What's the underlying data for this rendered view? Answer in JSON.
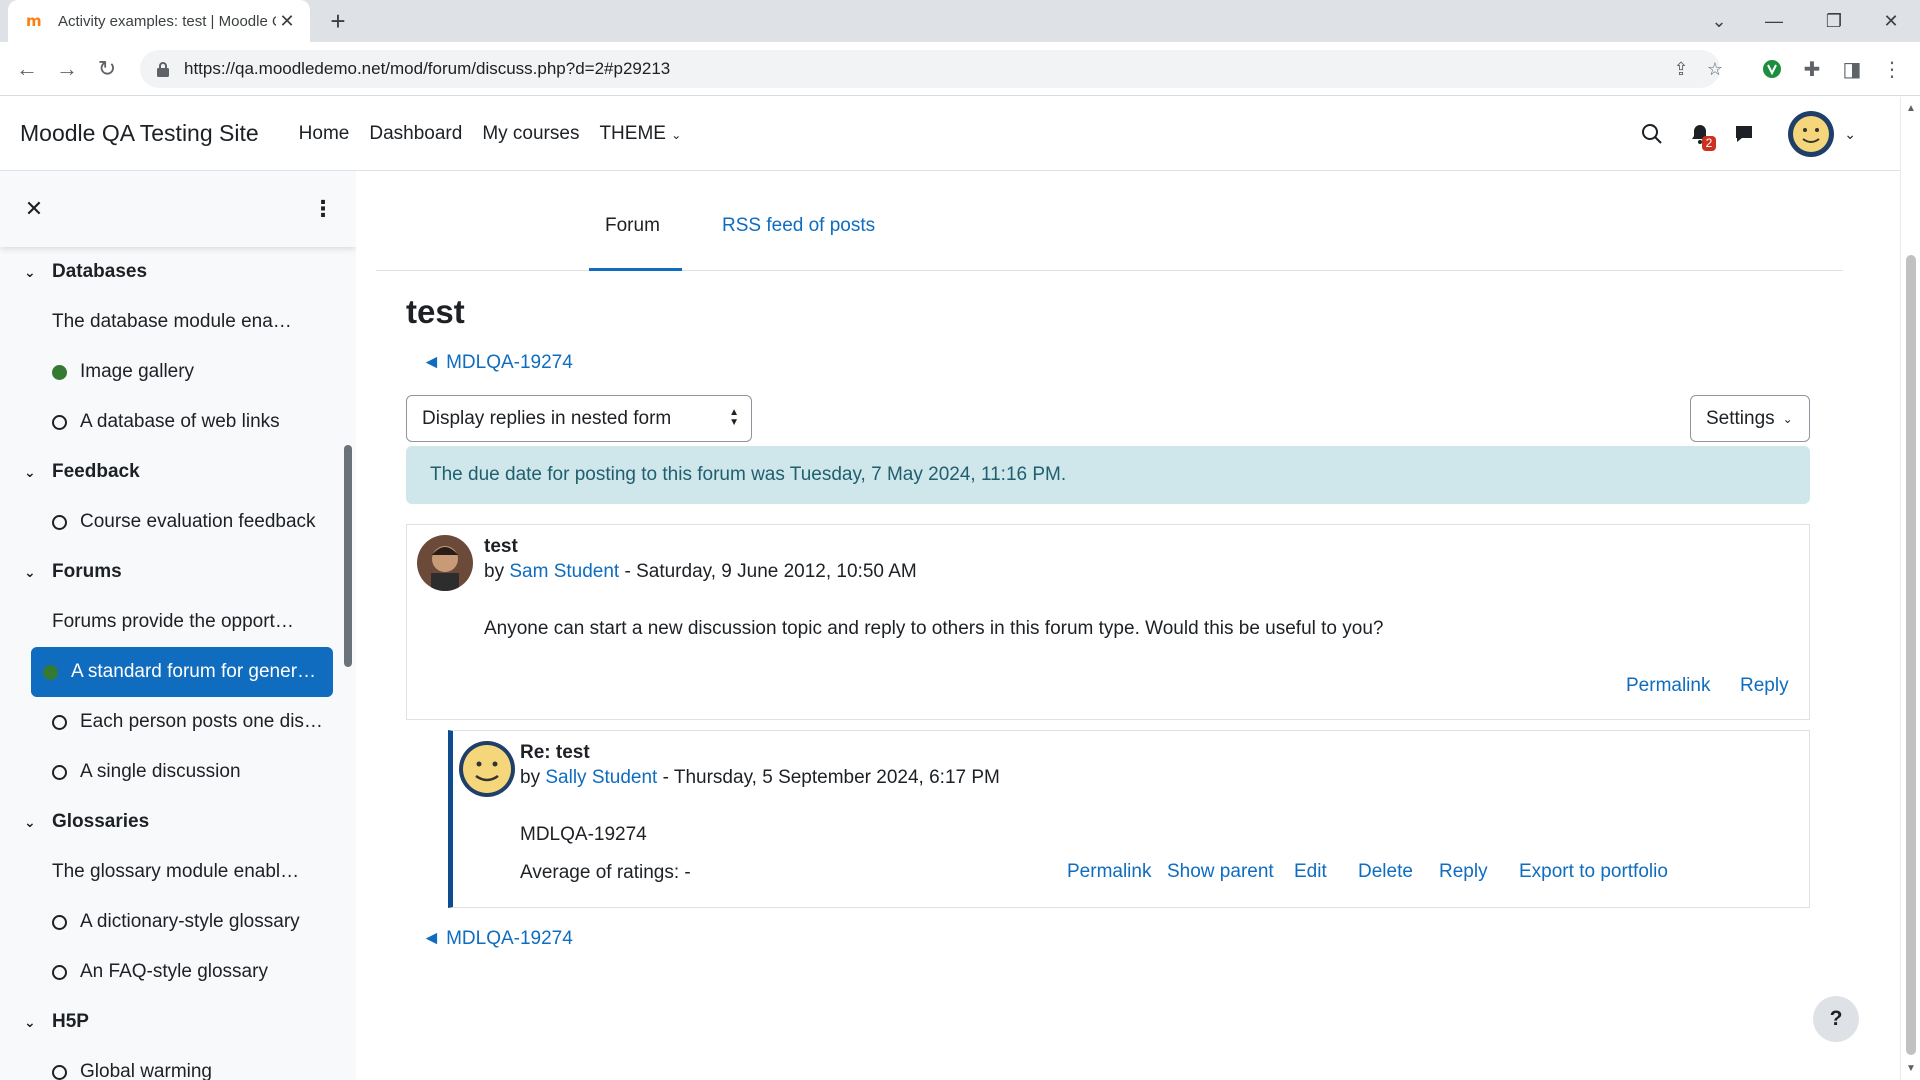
{
  "browser": {
    "tab_title": "Activity examples: test | Moodle QA Testing Site",
    "tab_favicon": "m",
    "tab_close": "✕",
    "new_tab": "+",
    "url": "https://qa.moodledemo.net/mod/forum/discuss.php?d=2#p29213"
  },
  "navbar": {
    "site_name": "Moodle QA Testing Site",
    "links": [
      "Home",
      "Dashboard",
      "My courses",
      "THEME"
    ],
    "notification_count": "2"
  },
  "drawer": {
    "close": "✕",
    "menu": "⋮",
    "sections": [
      {
        "title": "Databases",
        "items": [
          {
            "label": "The database module enables ...",
            "status": "summary"
          },
          {
            "label": "Image gallery",
            "status": "done"
          },
          {
            "label": "A database of web links",
            "status": "open"
          }
        ]
      },
      {
        "title": "Feedback",
        "items": [
          {
            "label": "Course evaluation feedback",
            "status": "open"
          }
        ]
      },
      {
        "title": "Forums",
        "items": [
          {
            "label": "Forums provide the opportunit...",
            "status": "summary"
          },
          {
            "label": "A standard forum for genera...",
            "status": "done",
            "active": true
          },
          {
            "label": "Each person posts one discu...",
            "status": "open"
          },
          {
            "label": "A single discussion",
            "status": "open"
          }
        ]
      },
      {
        "title": "Glossaries",
        "items": [
          {
            "label": "The glossary module enables p...",
            "status": "summary"
          },
          {
            "label": "A dictionary-style glossary",
            "status": "open"
          },
          {
            "label": "An FAQ-style glossary",
            "status": "open"
          }
        ]
      },
      {
        "title": "H5P",
        "items": [
          {
            "label": "Global warming",
            "status": "open"
          }
        ]
      }
    ]
  },
  "main": {
    "tabs": {
      "forum": "Forum",
      "rss": "RSS feed of posts"
    },
    "title": "test",
    "back_link_top": "◄ MDLQA-19274",
    "back_link_bottom": "◄ MDLQA-19274",
    "display_mode": "Display replies in nested form",
    "settings_label": "Settings",
    "alert": "The due date for posting to this forum was Tuesday, 7 May 2024, 11:16 PM.",
    "posts": [
      {
        "subject": "test",
        "by": "by ",
        "author": "Sam Student",
        "date": " - Saturday, 9 June 2012, 10:50 AM",
        "body": "Anyone can start a new discussion topic and reply to others in this forum type. Would this be useful to you?",
        "actions": [
          "Permalink",
          "Reply"
        ]
      },
      {
        "subject": "Re: test",
        "by": "by ",
        "author": "Sally Student",
        "date": " - Thursday, 5 September 2024, 6:17 PM",
        "body": "MDLQA-19274",
        "ratings": "Average of ratings: -",
        "actions": [
          "Permalink",
          "Show parent",
          "Edit",
          "Delete",
          "Reply",
          "Export to portfolio"
        ]
      }
    ],
    "help": "?"
  },
  "colors": {
    "accent": "#0f6cbf",
    "done": "#357a32",
    "alert_bg": "#cfe6ea"
  }
}
